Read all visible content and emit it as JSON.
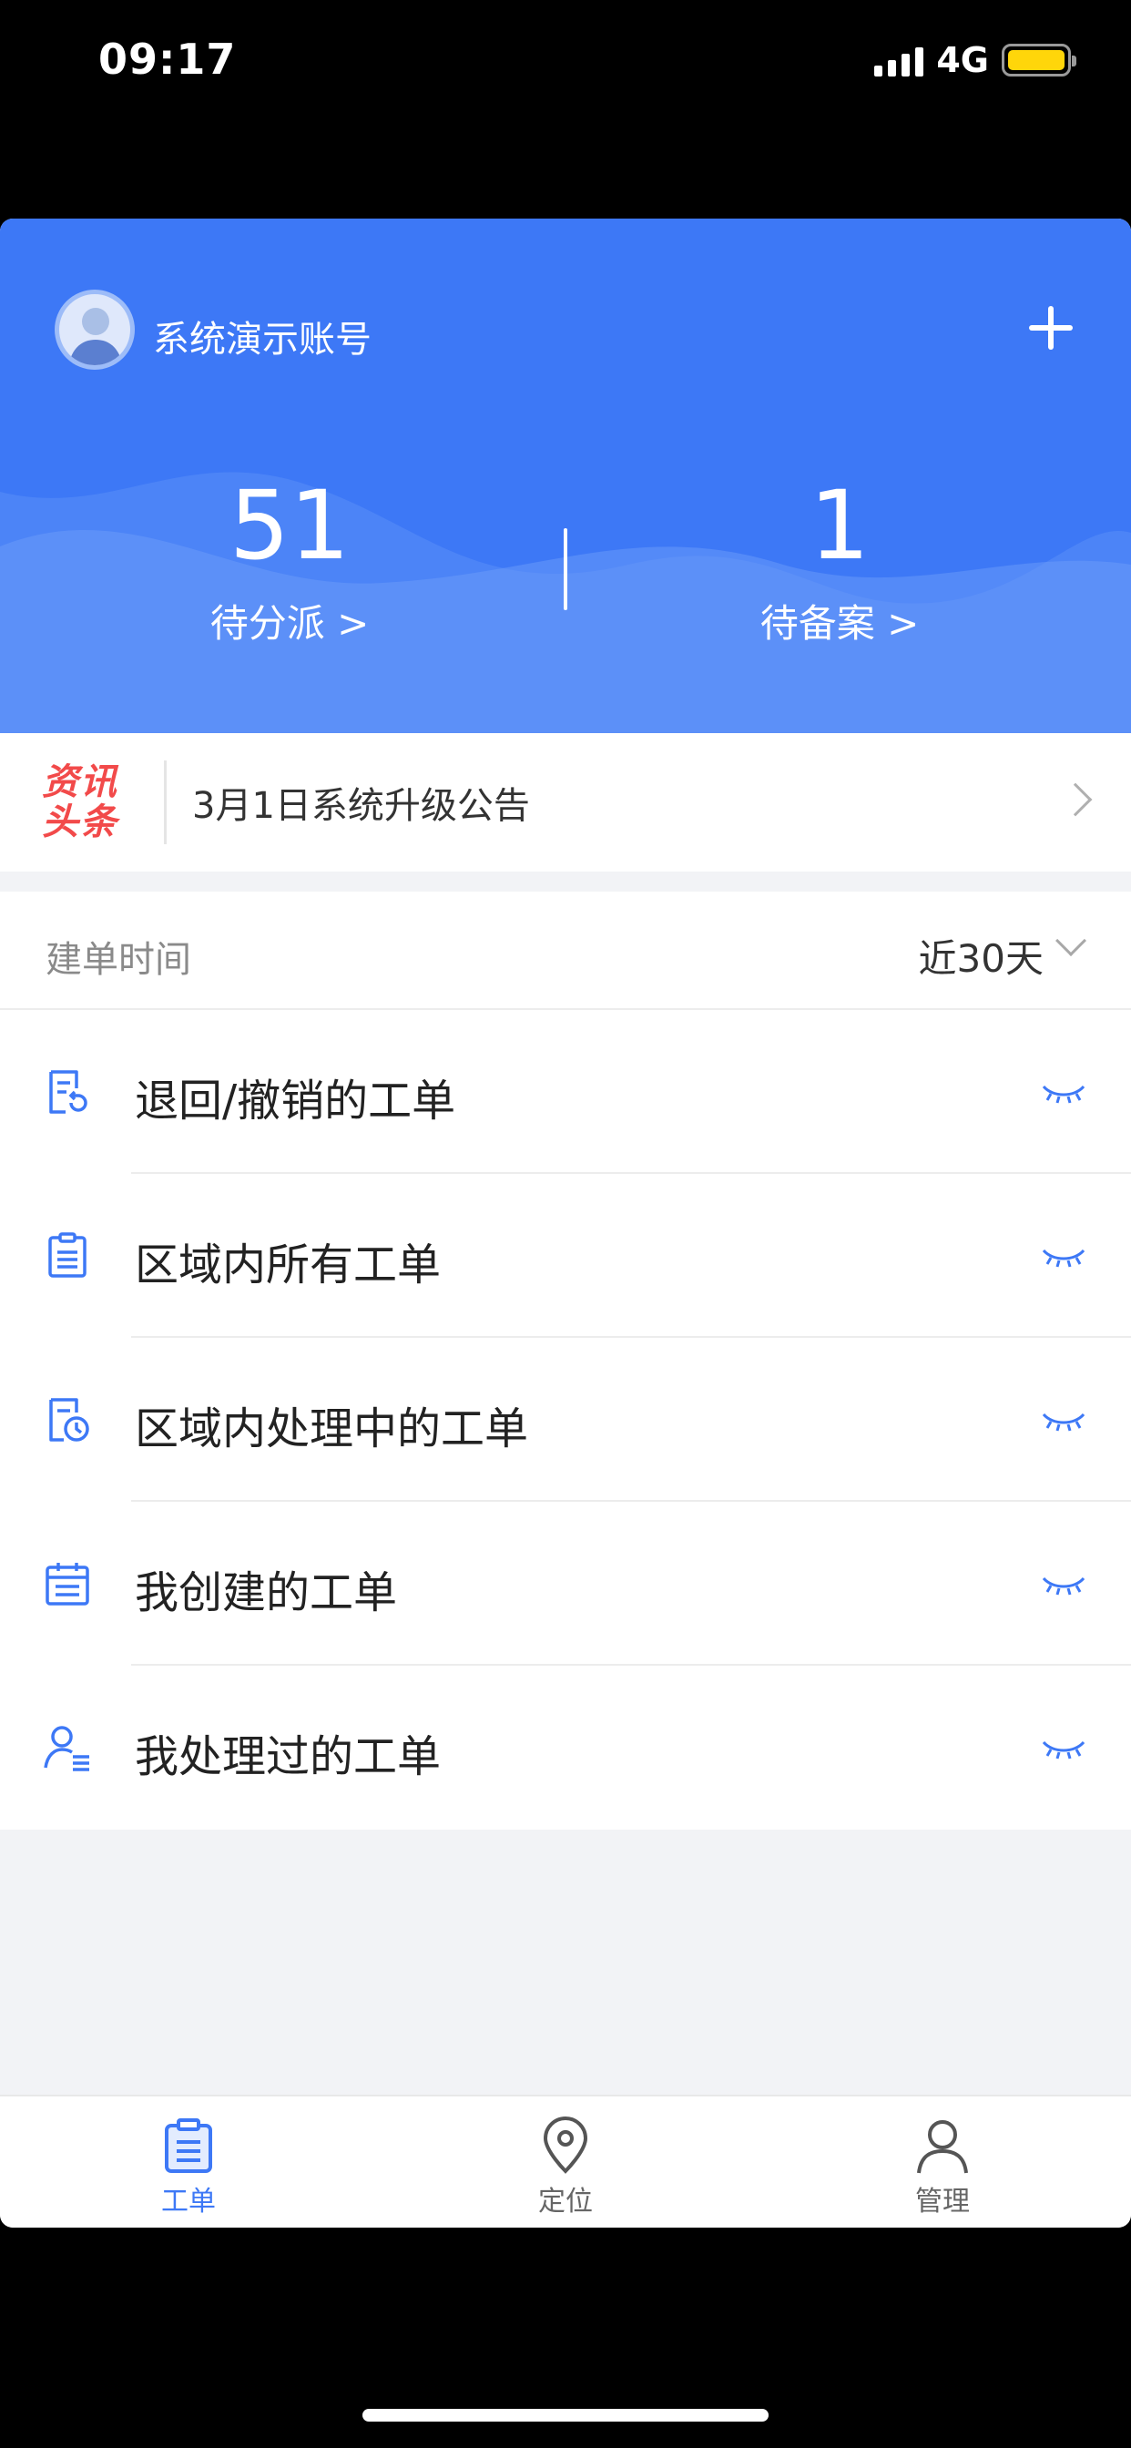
{
  "status_bar": {
    "time": "09:17",
    "network": "4G",
    "battery_color": "#ffd60a"
  },
  "header": {
    "username": "系统演示账号",
    "add_icon": "plus-icon",
    "avatar_icon": "avatar-icon",
    "accent_color": "#3d78f6",
    "stats": [
      {
        "value": "51",
        "label": "待分派 >"
      },
      {
        "value": "1",
        "label": "待备案 >"
      }
    ]
  },
  "news": {
    "logo_line1": "资讯",
    "logo_line2": "头条",
    "headline": "3月1日系统升级公告",
    "icon": "chevron-right-icon"
  },
  "filter": {
    "label": "建单时间",
    "value": "近30天",
    "icon": "chevron-down-icon"
  },
  "list": {
    "items": [
      {
        "label": "退回/撤销的工单",
        "icon": "return-document-icon"
      },
      {
        "label": "区域内所有工单",
        "icon": "clipboard-icon"
      },
      {
        "label": "区域内处理中的工单",
        "icon": "document-clock-icon"
      },
      {
        "label": "我创建的工单",
        "icon": "calendar-icon"
      },
      {
        "label": "我处理过的工单",
        "icon": "user-list-icon"
      }
    ],
    "eye_icon": "eye-closed-icon"
  },
  "tabbar": {
    "tabs": [
      {
        "label": "工单",
        "icon": "clipboard-icon",
        "active": true
      },
      {
        "label": "定位",
        "icon": "location-pin-icon",
        "active": false
      },
      {
        "label": "管理",
        "icon": "user-icon",
        "active": false
      }
    ]
  }
}
